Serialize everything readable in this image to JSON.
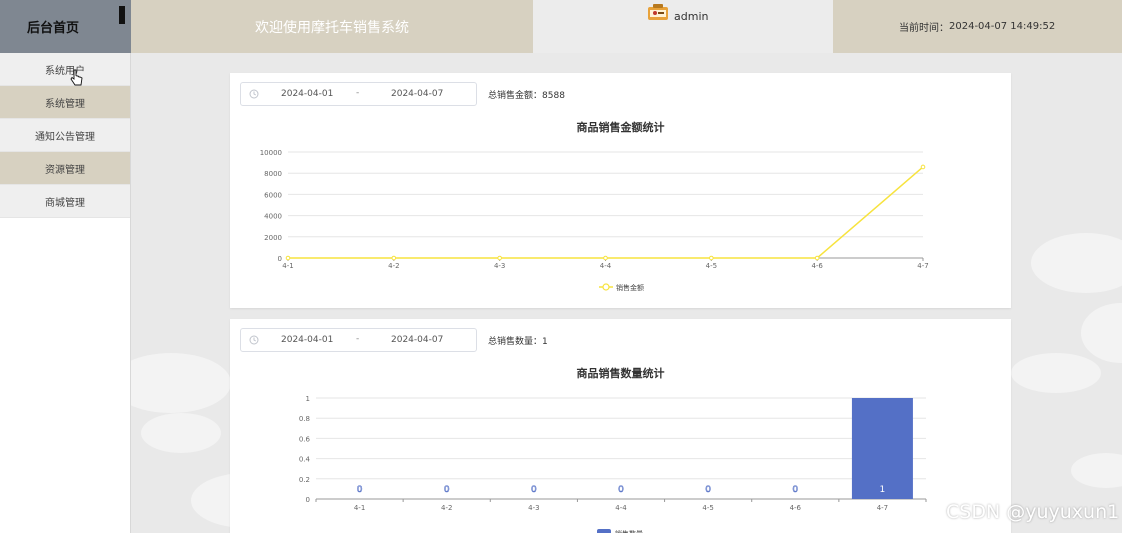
{
  "header": {
    "brand": "后台首页",
    "welcome": "欢迎使用摩托车销售系统",
    "user": "admin",
    "time_label": "当前时间：",
    "time_value": "2024-04-07 14:49:52"
  },
  "sidebar": {
    "items": [
      {
        "label": "系统用户"
      },
      {
        "label": "系统管理"
      },
      {
        "label": "通知公告管理"
      },
      {
        "label": "资源管理"
      },
      {
        "label": "商城管理"
      }
    ]
  },
  "cards": [
    {
      "date_start": "2024-04-01",
      "date_sep": "-",
      "date_end": "2024-04-07",
      "total_label": "总销售金额：",
      "total_value": "8588"
    },
    {
      "date_start": "2024-04-01",
      "date_sep": "-",
      "date_end": "2024-04-07",
      "total_label": "总销售数量：",
      "total_value": "1"
    }
  ],
  "chart_data": [
    {
      "type": "line",
      "title": "商品销售金额统计",
      "categories": [
        "4-1",
        "4-2",
        "4-3",
        "4-4",
        "4-5",
        "4-6",
        "4-7"
      ],
      "y_ticks": [
        "0",
        "2000",
        "4000",
        "6000",
        "8000",
        "10000"
      ],
      "ylim": [
        0,
        10000
      ],
      "grid": true,
      "legend_position": "bottom",
      "color": "#f7e33e",
      "series": [
        {
          "name": "销售金额",
          "values": [
            0,
            0,
            0,
            0,
            0,
            0,
            8588
          ]
        }
      ]
    },
    {
      "type": "bar",
      "title": "商品销售数量统计",
      "categories": [
        "4-1",
        "4-2",
        "4-3",
        "4-4",
        "4-5",
        "4-6",
        "4-7"
      ],
      "y_ticks": [
        "0",
        "0.2",
        "0.4",
        "0.6",
        "0.8",
        "1"
      ],
      "ylim": [
        0,
        1
      ],
      "grid": true,
      "legend_position": "bottom",
      "color": "#5470c6",
      "series": [
        {
          "name": "销售数量",
          "values": [
            0,
            0,
            0,
            0,
            0,
            0,
            1
          ]
        }
      ],
      "data_labels": [
        "0",
        "0",
        "0",
        "0",
        "0",
        "0",
        "1"
      ]
    }
  ],
  "watermark": "CSDN @yuyuxun1"
}
